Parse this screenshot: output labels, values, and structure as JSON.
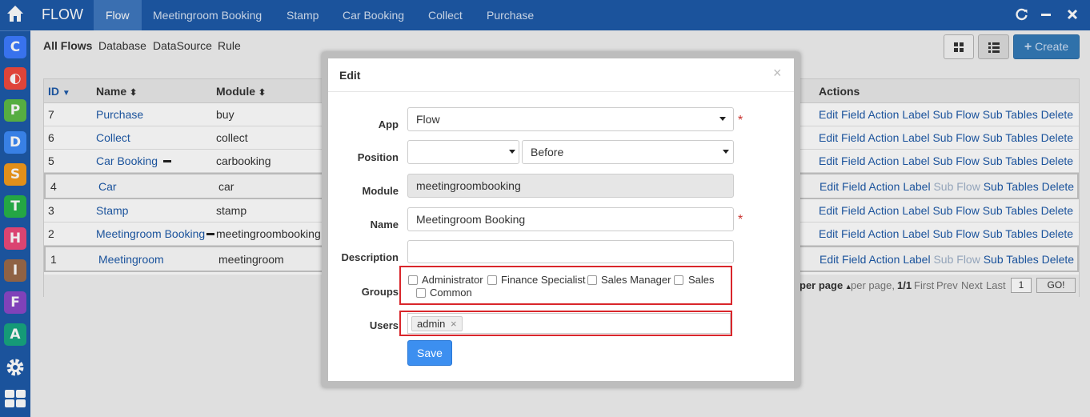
{
  "app": {
    "brand": "FLOW",
    "tabs": [
      "Flow",
      "Meetingroom Booking",
      "Stamp",
      "Car Booking",
      "Collect",
      "Purchase"
    ],
    "colors": {
      "bar": "#1e5aa8",
      "tab_active": "#3f78bf",
      "link": "#1e5aa8",
      "highlight": "#d9262b",
      "save": "#3c8ff0"
    }
  },
  "rail": {
    "apps": [
      {
        "icon": "c-icon",
        "glyph": "C",
        "color": "#3d7bff"
      },
      {
        "icon": "o-icon",
        "glyph": "◐",
        "color": "#f04a3e"
      },
      {
        "icon": "p-icon",
        "glyph": "P",
        "color": "#5dbb46"
      },
      {
        "icon": "d-icon",
        "glyph": "D",
        "color": "#3d8af7"
      },
      {
        "icon": "s-icon",
        "glyph": "S",
        "color": "#f39a1c"
      },
      {
        "icon": "t-icon",
        "glyph": "T",
        "color": "#27b34a"
      },
      {
        "icon": "h-icon",
        "glyph": "H",
        "color": "#ec4a7a"
      },
      {
        "icon": "i-icon",
        "glyph": "I",
        "color": "#9a6a4a"
      },
      {
        "icon": "f-icon",
        "glyph": "F",
        "color": "#8a48c8"
      },
      {
        "icon": "a-icon",
        "glyph": "A",
        "color": "#17a680"
      }
    ]
  },
  "subnav": {
    "items": [
      "All Flows",
      "Database",
      "DataSource",
      "Rule"
    ],
    "create_label": "Create"
  },
  "table": {
    "columns": [
      "ID",
      "Name",
      "Module",
      "Actions"
    ],
    "rows": [
      {
        "id": "7",
        "name": "Purchase",
        "module": "buy"
      },
      {
        "id": "6",
        "name": "Collect",
        "module": "collect"
      },
      {
        "id": "5",
        "name": "Car Booking",
        "module": "carbooking"
      },
      {
        "id": "4",
        "name": "Car",
        "module": "car"
      },
      {
        "id": "3",
        "name": "Stamp",
        "module": "stamp"
      },
      {
        "id": "2",
        "name": "Meetingroom Booking",
        "module": "meetingroombooking"
      },
      {
        "id": "1",
        "name": "Meetingroom",
        "module": "meetingroom"
      }
    ],
    "actions": [
      "Edit",
      "Field",
      "Action",
      "Label",
      "Sub Flow",
      "Sub Tables",
      "Delete"
    ],
    "pager": {
      "per_page": "per page",
      "per_page_suffix": "per page,",
      "pages": "1/1",
      "first": "First",
      "prev": "Prev",
      "next": "Next",
      "last": "Last",
      "page_value": "1",
      "go": "GO!"
    }
  },
  "modal": {
    "title": "Edit",
    "close": "×",
    "labels": {
      "app": "App",
      "position": "Position",
      "module": "Module",
      "name": "Name",
      "description": "Description",
      "groups": "Groups",
      "users": "Users"
    },
    "app_value": "Flow",
    "position_value": "",
    "position_order": "Before",
    "module_value": "meetingroombooking",
    "name_value": "Meetingroom Booking",
    "description_value": "",
    "groups": [
      "Administrator",
      "Finance Specialist",
      "Sales Manager",
      "Sales",
      "Common"
    ],
    "users": [
      "admin"
    ],
    "tag_remove": "×",
    "required_mark": "*",
    "save_label": "Save"
  }
}
